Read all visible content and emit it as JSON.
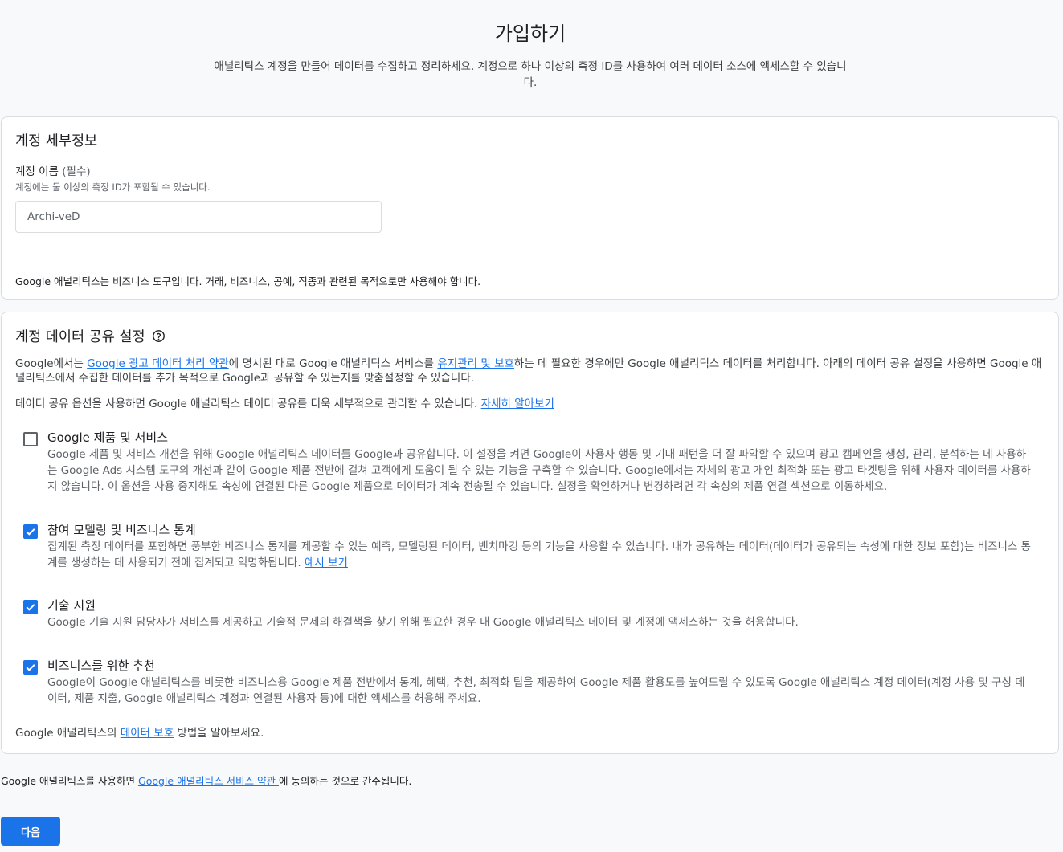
{
  "header": {
    "title": "가입하기",
    "subtitle": "애널리틱스 계정을 만들어 데이터를 수집하고 정리하세요. 계정으로 하나 이상의 측정 ID를 사용하여 여러 데이터 소스에 액세스할 수 있습니다."
  },
  "account_details": {
    "title": "계정 세부정보",
    "name_label": "계정 이름",
    "name_required": "(필수)",
    "name_help": "계정에는 둘 이상의 측정 ID가 포함될 수 있습니다.",
    "name_value": "Archi-veD",
    "note": "Google 애널리틱스는 비즈니스 도구입니다. 거래, 비즈니스, 공예, 직종과 관련된 목적으로만 사용해야 합니다."
  },
  "data_sharing": {
    "title": "계정 데이터 공유 설정",
    "help_icon": "help-circle-icon",
    "intro": {
      "p1": "Google에서는 ",
      "link1": "Google 광고 데이터 처리 약관",
      "p2": "에 명시된 대로 Google 애널리틱스 서비스를 ",
      "link2": "유지관리 및 보호",
      "p3": "하는 데 필요한 경우에만 Google 애널리틱스 데이터를 처리합니다. 아래의 데이터 공유 설정을 사용하면 Google 애널리틱스에서 수집한 데이터를 추가 목적으로 Google과 공유할 수 있는지를 맞춤설정할 수 있습니다."
    },
    "options_intro": {
      "text": "데이터 공유 옵션을 사용하면 Google 애널리틱스 데이터 공유를 더욱 세부적으로 관리할 수 있습니다. ",
      "link": "자세히 알아보기"
    },
    "options": [
      {
        "title": "Google 제품 및 서비스",
        "checked": false,
        "desc": "Google 제품 및 서비스 개선을 위해 Google 애널리틱스 데이터를 Google과 공유합니다. 이 설정을 켜면 Google이 사용자 행동 및 기대 패턴을 더 잘 파악할 수 있으며 광고 캠페인을 생성, 관리, 분석하는 데 사용하는 Google Ads 시스템 도구의 개선과 같이 Google 제품 전반에 걸쳐 고객에게 도움이 될 수 있는 기능을 구축할 수 있습니다. Google에서는 자체의 광고 개인 최적화 또는 광고 타겟팅을 위해 사용자 데이터를 사용하지 않습니다. 이 옵션을 사용 중지해도 속성에 연결된 다른 Google 제품으로 데이터가 계속 전송될 수 있습니다. 설정을 확인하거나 변경하려면 각 속성의 제품 연결 섹션으로 이동하세요."
      },
      {
        "title": "참여 모델링 및 비즈니스 통계",
        "checked": true,
        "desc": "집계된 측정 데이터를 포함하면 풍부한 비즈니스 통계를 제공할 수 있는 예측, 모델링된 데이터, 벤치마킹 등의 기능을 사용할 수 있습니다. 내가 공유하는 데이터(데이터가 공유되는 속성에 대한 정보 포함)는 비즈니스 통계를 생성하는 데 사용되기 전에 집계되고 익명화됩니다. ",
        "link": "예시 보기"
      },
      {
        "title": "기술 지원",
        "checked": true,
        "desc": "Google 기술 지원 담당자가 서비스를 제공하고 기술적 문제의 해결책을 찾기 위해 필요한 경우 내 Google 애널리틱스 데이터 및 계정에 액세스하는 것을 허용합니다."
      },
      {
        "title": "비즈니스를 위한 추천",
        "checked": true,
        "desc": "Google이 Google 애널리틱스를 비롯한 비즈니스용 Google 제품 전반에서 통계, 혜택, 추천, 최적화 팁을 제공하여 Google 제품 활용도를 높여드릴 수 있도록 Google 애널리틱스 계정 데이터(계정 사용 및 구성 데이터, 제품 지출, Google 애널리틱스 계정과 연결된 사용자 등)에 대한 액세스를 허용해 주세요."
      }
    ],
    "footer": {
      "p1": "Google 애널리틱스의 ",
      "link": "데이터 보호",
      "p2": " 방법을 알아보세요."
    }
  },
  "terms": {
    "p1": "Google 애널리틱스를 사용하면 ",
    "link": "Google 애널리틱스 서비스 약관 ",
    "p2": "에 동의하는 것으로 간주됩니다."
  },
  "next_button": "다음",
  "colors": {
    "accent": "#1a73e8",
    "background": "#f8f9fa",
    "card_border": "#dadce0"
  }
}
